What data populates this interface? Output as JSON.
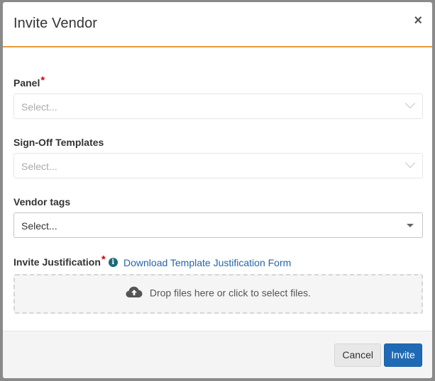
{
  "modal": {
    "title": "Invite Vendor",
    "close_label": "×"
  },
  "fields": {
    "panel": {
      "label": "Panel",
      "required_mark": "*",
      "placeholder": "Select..."
    },
    "signoff": {
      "label": "Sign-Off Templates",
      "placeholder": "Select..."
    },
    "vendor_tags": {
      "label": "Vendor tags",
      "placeholder": "Select..."
    },
    "justification": {
      "label": "Invite Justification",
      "required_mark": "*",
      "info_glyph": "i",
      "download_link": "Download Template Justification Form",
      "dropzone_text": "Drop files here or click to select files."
    }
  },
  "footer": {
    "cancel_label": "Cancel",
    "invite_label": "Invite"
  },
  "colors": {
    "accent_border": "#e89a3c",
    "primary_button": "#1f6ab5",
    "link": "#2266aa",
    "required": "#d0021b",
    "info_icon": "#1a6a7a"
  }
}
